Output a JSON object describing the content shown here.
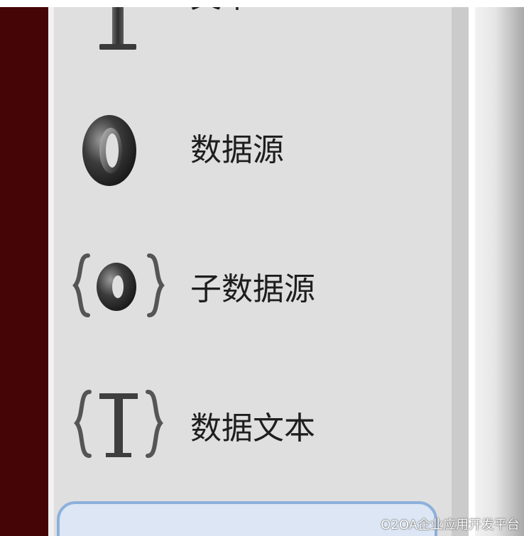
{
  "colors": {
    "left_strip": "#450405",
    "palette_bg": "#dfdfdf",
    "scroll_track": "#cbcbcb",
    "selected_border": "#8db0dc",
    "selected_bg": "#dce6f4",
    "label_text": "#1e1e1e"
  },
  "palette": {
    "items": [
      {
        "label": "文本",
        "icon": "text-t-icon"
      },
      {
        "label": "数据源",
        "icon": "ring-datasource-icon"
      },
      {
        "label": "子数据源",
        "icon": "braced-ring-icon"
      },
      {
        "label": "数据文本",
        "icon": "braced-t-icon"
      }
    ]
  },
  "watermark": "O2OA企业应用开发平台"
}
